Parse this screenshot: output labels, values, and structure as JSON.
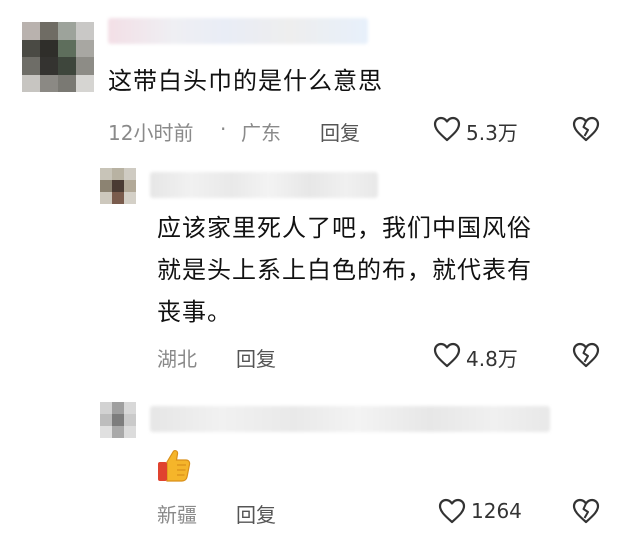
{
  "comments": [
    {
      "text": "这带白头巾的是什么意思",
      "time": "12小时前",
      "location": "广东",
      "reply_label": "回复",
      "likes": "5.3万"
    },
    {
      "text_lines": [
        "应该家里死人了吧，我们中国风俗",
        "就是头上系上白色的布，就代表有",
        "丧事。"
      ],
      "location": "湖北",
      "reply_label": "回复",
      "likes": "4.8万"
    },
    {
      "emoji": "👍",
      "location": "新疆",
      "reply_label": "回复",
      "likes": "1264"
    }
  ],
  "meta_separator": "·",
  "icons": {
    "like": "heart-outline-icon",
    "dislike": "broken-heart-icon"
  },
  "colors": {
    "meta": "#8a8a8a",
    "text": "#111111",
    "thumb": "#f5b52a"
  }
}
